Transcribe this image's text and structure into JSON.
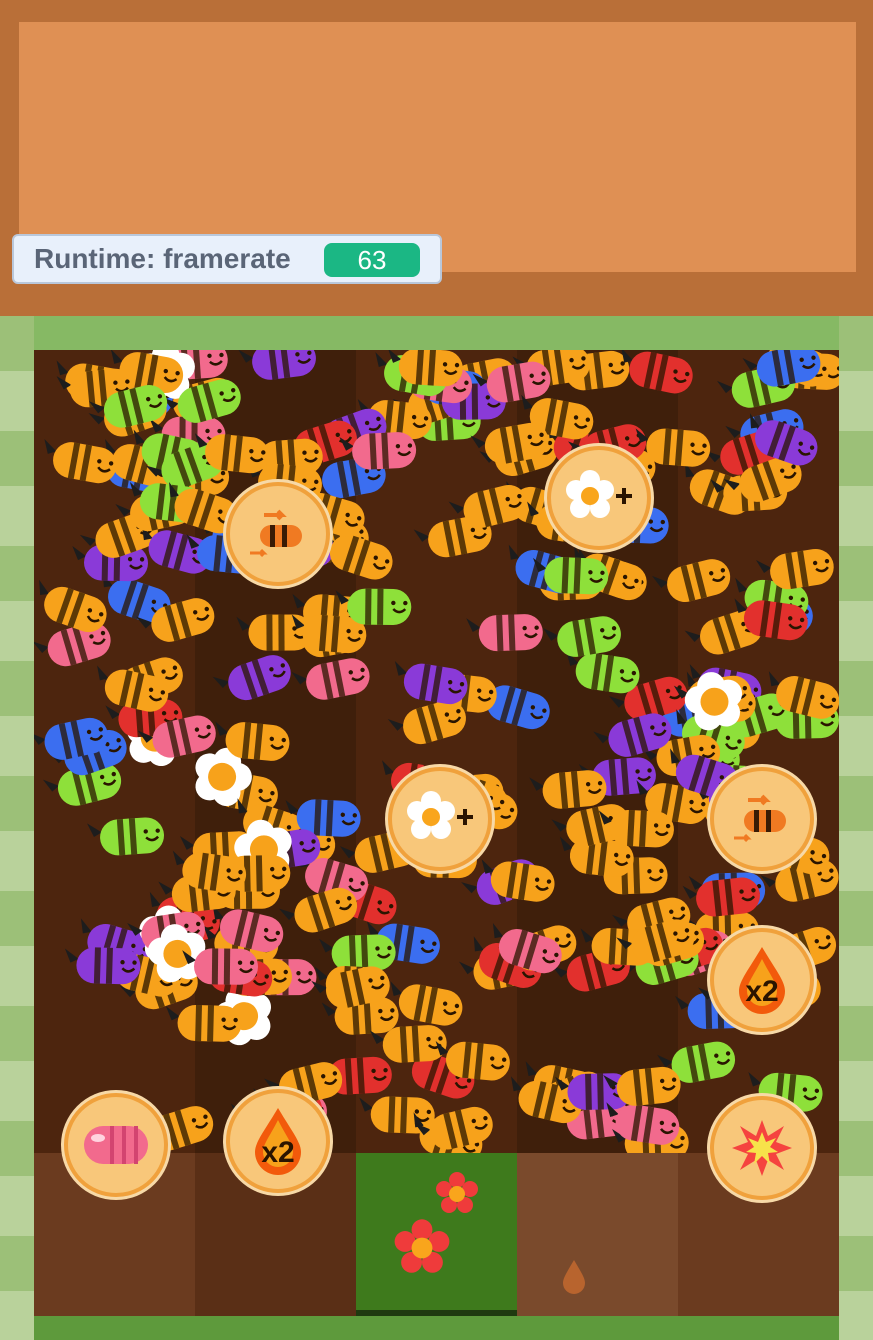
{
  "hud": {
    "label": "Runtime: framerate",
    "value": "63"
  },
  "powerups": [
    {
      "type": "bee-speed",
      "icon": "speed-bee-icon"
    },
    {
      "type": "flower-plus",
      "icon": "flower-plus-icon"
    },
    {
      "type": "flower-plus",
      "icon": "flower-plus-icon"
    },
    {
      "type": "bee-speed",
      "icon": "speed-bee-icon"
    },
    {
      "type": "honey-x2",
      "icon": "honey-drop-x2-icon",
      "text": "x2"
    },
    {
      "type": "pink-bee",
      "icon": "pink-bee-icon"
    },
    {
      "type": "honey-x2",
      "icon": "honey-drop-x2-icon",
      "text": "x2"
    },
    {
      "type": "explosion",
      "icon": "explosion-icon"
    }
  ],
  "colors": {
    "board": "#4a230d",
    "panel": "#df9054",
    "hud_value_bg": "#1bb784",
    "bee_orange": "#f7a21b",
    "bee_blue": "#3b6ef0",
    "bee_purple": "#8a3ad8",
    "bee_pink": "#f26a8d",
    "bee_red": "#e2302d",
    "bee_green": "#8ee03a"
  }
}
